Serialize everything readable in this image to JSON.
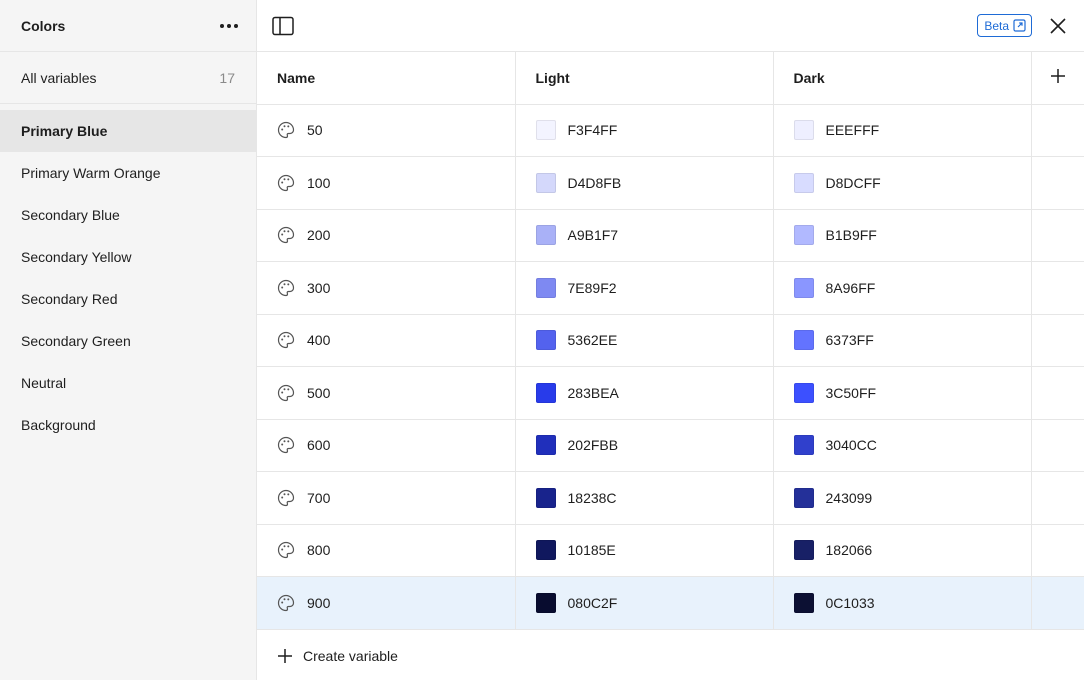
{
  "sidebar": {
    "title": "Colors",
    "more_icon": "ellipsis-icon",
    "all_variables": {
      "label": "All variables",
      "count": "17"
    },
    "groups": [
      {
        "label": "Primary Blue",
        "active": true
      },
      {
        "label": "Primary Warm Orange"
      },
      {
        "label": "Secondary Blue"
      },
      {
        "label": "Secondary Yellow"
      },
      {
        "label": "Secondary Red"
      },
      {
        "label": "Secondary Green"
      },
      {
        "label": "Neutral"
      },
      {
        "label": "Background"
      }
    ]
  },
  "topbar": {
    "panel_icon": "sidebar-toggle-icon",
    "beta_label": "Beta",
    "close_icon": "close-icon"
  },
  "table": {
    "headers": {
      "name": "Name",
      "light": "Light",
      "dark": "Dark",
      "add": "+"
    },
    "rows": [
      {
        "name": "50",
        "light": "F3F4FF",
        "dark": "EEEFFF"
      },
      {
        "name": "100",
        "light": "D4D8FB",
        "dark": "D8DCFF"
      },
      {
        "name": "200",
        "light": "A9B1F7",
        "dark": "B1B9FF"
      },
      {
        "name": "300",
        "light": "7E89F2",
        "dark": "8A96FF"
      },
      {
        "name": "400",
        "light": "5362EE",
        "dark": "6373FF"
      },
      {
        "name": "500",
        "light": "283BEA",
        "dark": "3C50FF"
      },
      {
        "name": "600",
        "light": "202FBB",
        "dark": "3040CC"
      },
      {
        "name": "700",
        "light": "18238C",
        "dark": "243099"
      },
      {
        "name": "800",
        "light": "10185E",
        "dark": "182066"
      },
      {
        "name": "900",
        "light": "080C2F",
        "dark": "0C1033",
        "selected": true
      }
    ]
  },
  "footer": {
    "create_label": "Create variable",
    "icon": "plus-icon"
  },
  "colors": {
    "accent": "#1e6bd6",
    "selected_row": "#e8f2fc",
    "sidebar_bg": "#f5f5f5"
  }
}
